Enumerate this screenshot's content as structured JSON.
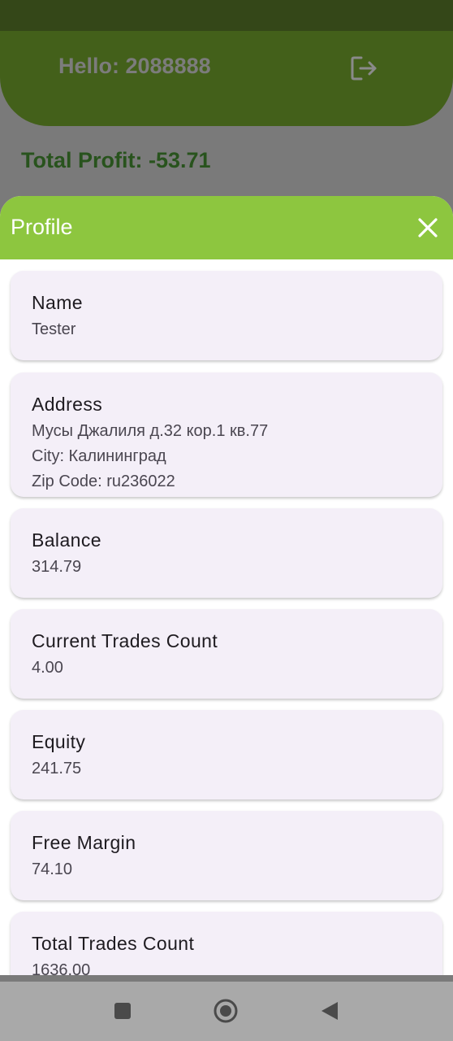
{
  "header": {
    "greeting": "Hello: 2088888",
    "logout_icon": "logout-icon"
  },
  "summary": {
    "total_profit": "Total Profit: -53.71"
  },
  "sheet": {
    "title": "Profile",
    "close_icon": "close-icon",
    "cards": [
      {
        "label": "Name",
        "lines": [
          "Tester"
        ]
      },
      {
        "label": "Address",
        "lines": [
          "Мусы Джалиля д.32 кор.1 кв.77",
          "City: Калининград",
          "Zip Code: ru236022"
        ]
      },
      {
        "label": "Balance",
        "lines": [
          "314.79"
        ]
      },
      {
        "label": "Current Trades Count",
        "lines": [
          "4.00"
        ]
      },
      {
        "label": "Equity",
        "lines": [
          "241.75"
        ]
      },
      {
        "label": "Free Margin",
        "lines": [
          "74.10"
        ]
      },
      {
        "label": "Total Trades Count",
        "lines": [
          "1636.00"
        ]
      }
    ]
  },
  "colors": {
    "sheet_header": "#8dc63f",
    "app_header": "#43601a",
    "profit_text": "#28531d",
    "card_bg": "#f4eff8"
  },
  "nav": {
    "icons": [
      "square-icon",
      "home-circle-icon",
      "back-triangle-icon"
    ]
  }
}
